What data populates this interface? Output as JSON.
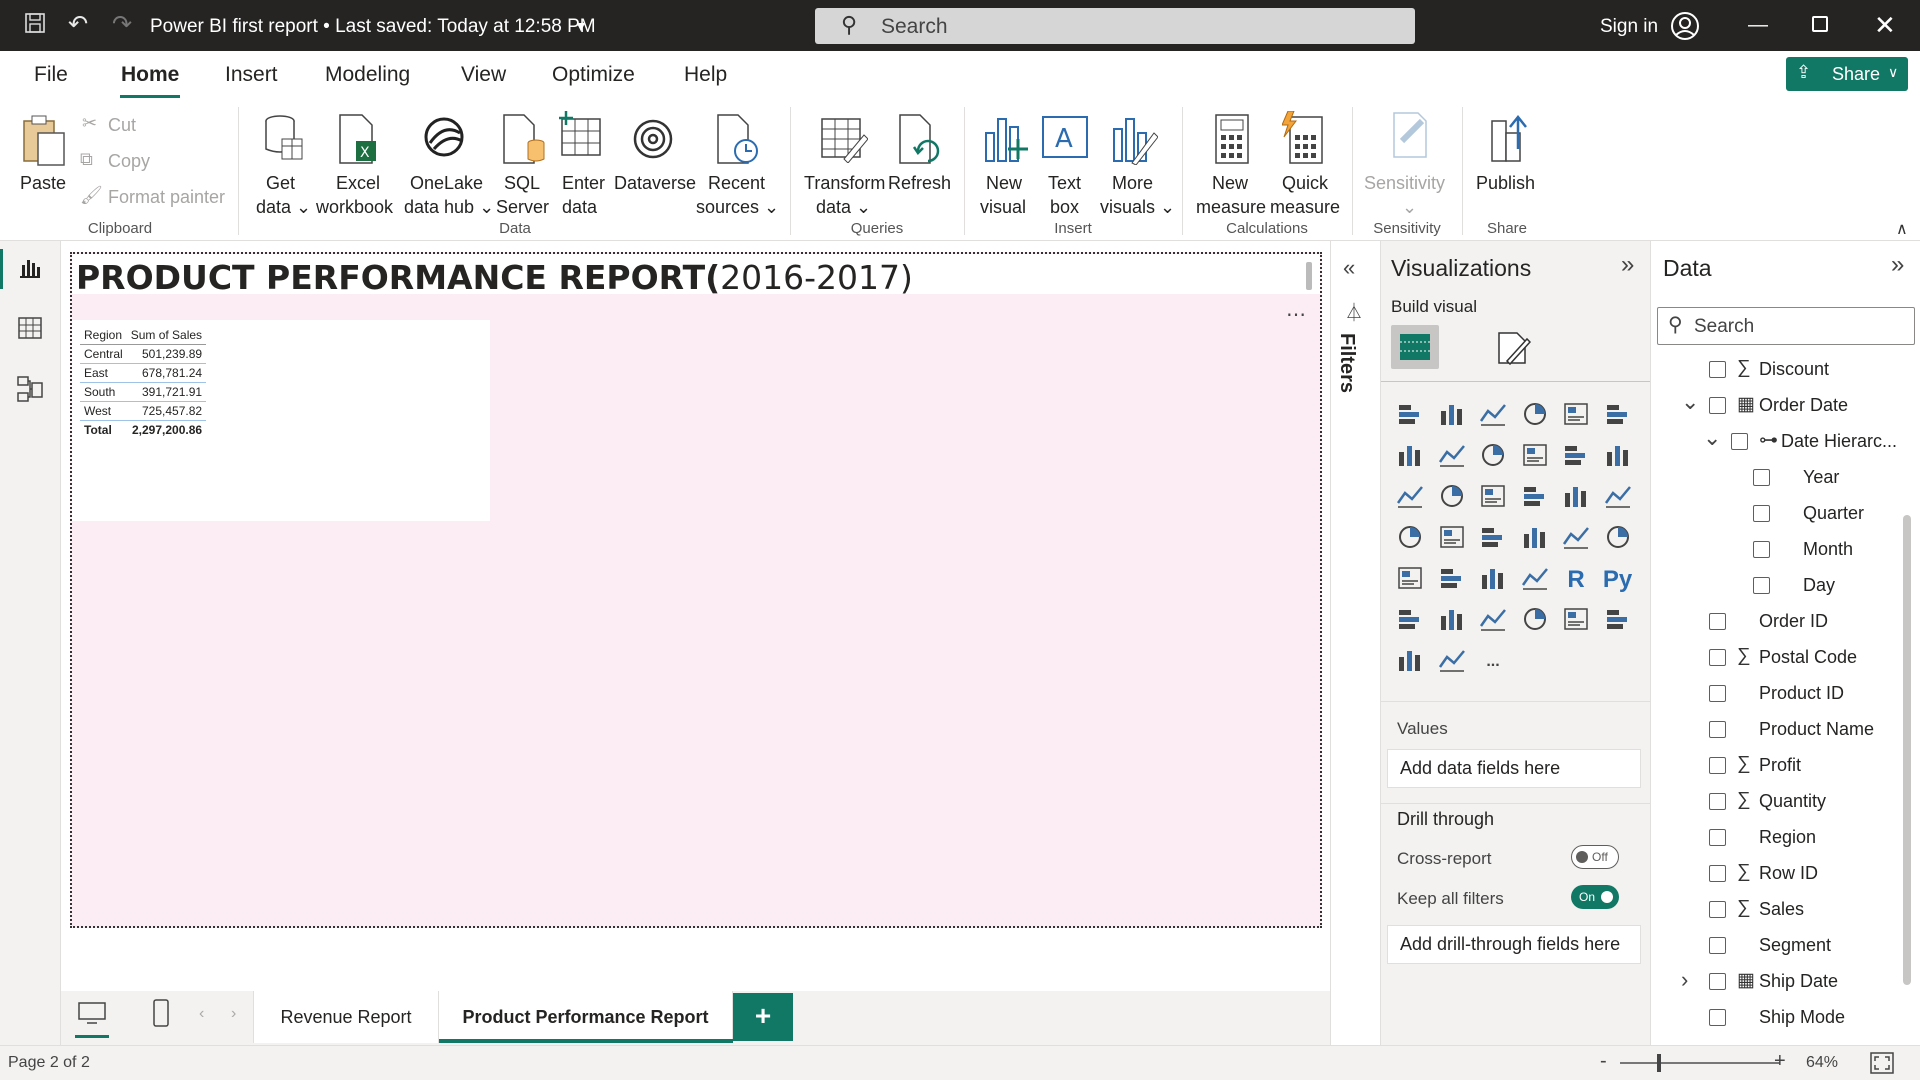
{
  "titlebar": {
    "title": "Power BI first report • Last saved: Today at 12:58 PM",
    "search_placeholder": "Search",
    "sign_in": "Sign in",
    "share": "Share"
  },
  "menu": {
    "tabs": [
      "File",
      "Home",
      "Insert",
      "Modeling",
      "View",
      "Optimize",
      "Help"
    ],
    "active": "Home"
  },
  "ribbon": {
    "clipboard": {
      "paste": "Paste",
      "cut": "Cut",
      "copy": "Copy",
      "format_painter": "Format painter",
      "group": "Clipboard"
    },
    "data": {
      "get_data_1": "Get",
      "get_data_2": "data",
      "excel_1": "Excel",
      "excel_2": "workbook",
      "onelake_1": "OneLake",
      "onelake_2": "data hub",
      "sql_1": "SQL",
      "sql_2": "Server",
      "enter_1": "Enter",
      "enter_2": "data",
      "dataverse": "Dataverse",
      "recent_1": "Recent",
      "recent_2": "sources",
      "group": "Data"
    },
    "queries": {
      "transform_1": "Transform",
      "transform_2": "data",
      "refresh": "Refresh",
      "group": "Queries"
    },
    "insert": {
      "new_visual_1": "New",
      "new_visual_2": "visual",
      "textbox_1": "Text",
      "textbox_2": "box",
      "more_1": "More",
      "more_2": "visuals",
      "group": "Insert"
    },
    "calculations": {
      "new_measure_1": "New",
      "new_measure_2": "measure",
      "quick_measure_1": "Quick",
      "quick_measure_2": "measure",
      "group": "Calculations"
    },
    "sensitivity": {
      "label": "Sensitivity",
      "group": "Sensitivity"
    },
    "share": {
      "publish": "Publish",
      "group": "Share"
    }
  },
  "report": {
    "title_bold": "PRODUCT PERFORMANCE REPORT(",
    "title_light": "2016-2017)",
    "table": {
      "headers": [
        "Region",
        "Sum of Sales"
      ],
      "rows": [
        [
          "Central",
          "501,239.89"
        ],
        [
          "East",
          "678,781.24"
        ],
        [
          "South",
          "391,721.91"
        ],
        [
          "West",
          "725,457.82"
        ]
      ],
      "total": [
        "Total",
        "2,297,200.86"
      ]
    }
  },
  "tabs": {
    "items": [
      "Revenue Report",
      "Product Performance Report"
    ],
    "active": "Product Performance Report",
    "add": "+"
  },
  "status": {
    "page": "Page 2 of 2",
    "zoom": "64%",
    "minus": "-",
    "plus": "+"
  },
  "filters": {
    "label": "Filters"
  },
  "visualizations": {
    "title": "Visualizations",
    "build_visual": "Build visual",
    "values_label": "Values",
    "values_placeholder": "Add data fields here",
    "drill_title": "Drill through",
    "cross_report": "Cross-report",
    "cross_report_state": "Off",
    "keep_filters": "Keep all filters",
    "keep_filters_state": "On",
    "drill_placeholder": "Add drill-through fields here",
    "r_icon": "R",
    "py_icon": "Py",
    "more": "..."
  },
  "data_pane": {
    "title": "Data",
    "search_placeholder": "Search",
    "fields": [
      {
        "name": "Discount",
        "sigma": true,
        "indent": 0
      },
      {
        "name": "Order Date",
        "calendar": true,
        "expanded": true,
        "indent": 0
      },
      {
        "name": "Date Hierarc...",
        "hierarchy": true,
        "expanded": true,
        "indent": 1
      },
      {
        "name": "Year",
        "indent": 2
      },
      {
        "name": "Quarter",
        "indent": 2
      },
      {
        "name": "Month",
        "indent": 2
      },
      {
        "name": "Day",
        "indent": 2
      },
      {
        "name": "Order ID",
        "indent": 0
      },
      {
        "name": "Postal Code",
        "sigma": true,
        "indent": 0
      },
      {
        "name": "Product ID",
        "indent": 0
      },
      {
        "name": "Product Name",
        "indent": 0
      },
      {
        "name": "Profit",
        "sigma": true,
        "indent": 0
      },
      {
        "name": "Quantity",
        "sigma": true,
        "indent": 0
      },
      {
        "name": "Region",
        "indent": 0
      },
      {
        "name": "Row ID",
        "sigma": true,
        "indent": 0
      },
      {
        "name": "Sales",
        "sigma": true,
        "indent": 0
      },
      {
        "name": "Segment",
        "indent": 0
      },
      {
        "name": "Ship Date",
        "calendar": true,
        "collapsed": true,
        "indent": 0
      },
      {
        "name": "Ship Mode",
        "indent": 0
      }
    ]
  },
  "colors": {
    "accent": "#117865",
    "titlebar": "#252423",
    "canvas": "#fcedf5"
  }
}
